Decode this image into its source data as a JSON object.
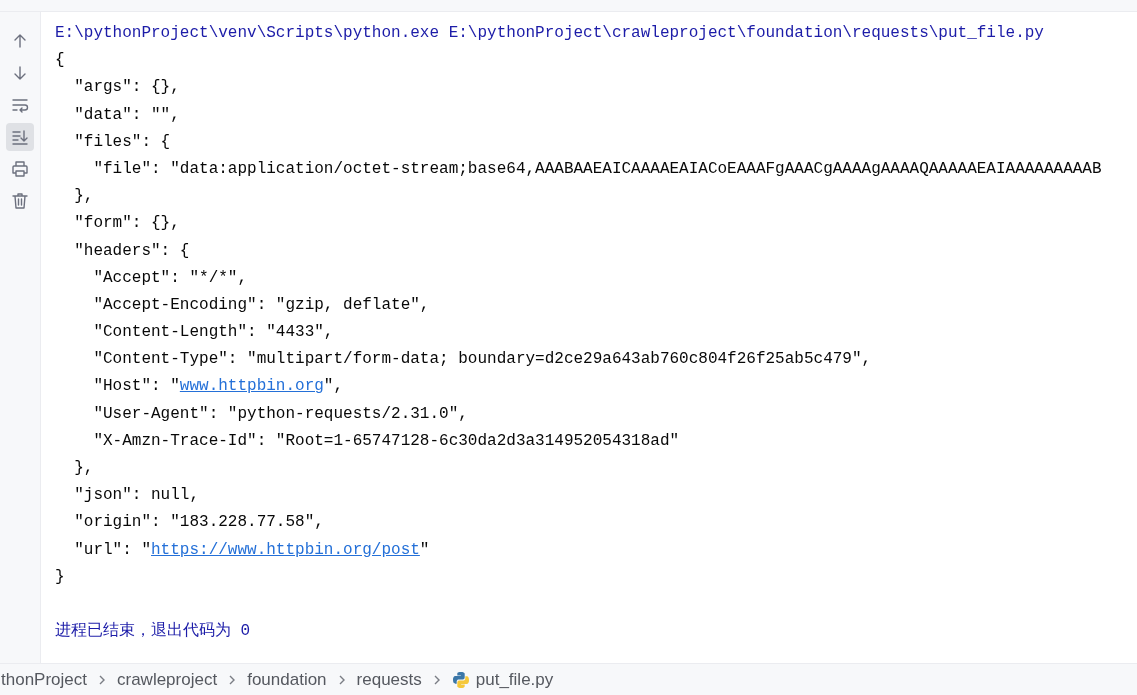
{
  "toolbar": {
    "buttons": [
      {
        "kind": "up",
        "selected": false
      },
      {
        "kind": "down",
        "selected": false
      },
      {
        "kind": "wrap",
        "selected": false
      },
      {
        "kind": "scroll-end",
        "selected": true
      },
      {
        "kind": "print",
        "selected": false
      },
      {
        "kind": "trash",
        "selected": false
      }
    ]
  },
  "console": {
    "lines": [
      {
        "kind": "command",
        "text": "E:\\pythonProject\\venv\\Scripts\\python.exe E:\\pythonProject\\crawleproject\\foundation\\requests\\put_file.py"
      },
      {
        "kind": "output",
        "text": "{"
      },
      {
        "kind": "output",
        "text": "  \"args\": {},"
      },
      {
        "kind": "output",
        "text": "  \"data\": \"\","
      },
      {
        "kind": "output",
        "text": "  \"files\": {"
      },
      {
        "kind": "output",
        "text": "    \"file\": \"data:application/octet-stream;base64,AAABAAEAICAAAAEAIACoEAAAFgAAACgAAAAgAAAAQAAAAAEAIAAAAAAAAAB"
      },
      {
        "kind": "output",
        "text": "  },"
      },
      {
        "kind": "output",
        "text": "  \"form\": {},"
      },
      {
        "kind": "output",
        "text": "  \"headers\": {"
      },
      {
        "kind": "output",
        "text": "    \"Accept\": \"*/*\","
      },
      {
        "kind": "output",
        "text": "    \"Accept-Encoding\": \"gzip, deflate\","
      },
      {
        "kind": "output",
        "text": "    \"Content-Length\": \"4433\","
      },
      {
        "kind": "output",
        "text": "    \"Content-Type\": \"multipart/form-data; boundary=d2ce29a643ab760c804f26f25ab5c479\","
      },
      {
        "kind": "output",
        "parts": [
          {
            "kind": "text",
            "text": "    \"Host\": \""
          },
          {
            "kind": "link",
            "text": "www.httpbin.org"
          },
          {
            "kind": "text",
            "text": "\","
          }
        ]
      },
      {
        "kind": "output",
        "text": "    \"User-Agent\": \"python-requests/2.31.0\","
      },
      {
        "kind": "output",
        "text": "    \"X-Amzn-Trace-Id\": \"Root=1-65747128-6c30da2d3a314952054318ad\""
      },
      {
        "kind": "output",
        "text": "  },"
      },
      {
        "kind": "output",
        "text": "  \"json\": null,"
      },
      {
        "kind": "output",
        "text": "  \"origin\": \"183.228.77.58\","
      },
      {
        "kind": "output",
        "parts": [
          {
            "kind": "text",
            "text": "  \"url\": \""
          },
          {
            "kind": "link",
            "text": "https://www.httpbin.org/post"
          },
          {
            "kind": "text",
            "text": "\""
          }
        ]
      },
      {
        "kind": "output",
        "text": "}"
      },
      {
        "kind": "blank"
      },
      {
        "kind": "command",
        "text": "进程已结束，退出代码为 0"
      }
    ]
  },
  "breadcrumb": {
    "items": [
      {
        "kind": "folder",
        "text": "thonProject"
      },
      {
        "kind": "folder",
        "text": "crawleproject"
      },
      {
        "kind": "folder",
        "text": "foundation"
      },
      {
        "kind": "folder",
        "text": "requests"
      },
      {
        "kind": "python-file",
        "text": "put_file.py"
      }
    ]
  }
}
